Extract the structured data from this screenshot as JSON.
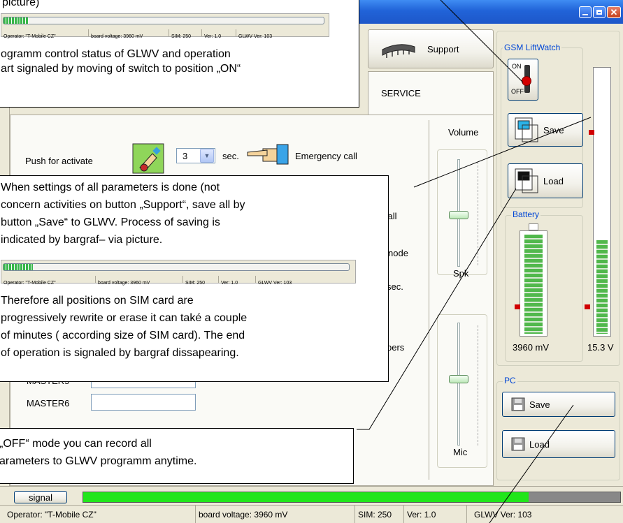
{
  "window": {
    "title_buttons": [
      "minimize-icon",
      "maximize-icon",
      "close-icon"
    ]
  },
  "tabs": {
    "support": "Support",
    "service": "SERVICE"
  },
  "form": {
    "push_label": "Push for activate",
    "seconds_value": "3",
    "sec_label": "sec.",
    "emergency_label": "Emergency call",
    "call_fragment": "call",
    "mode_fragment": "node",
    "sec_fragment": "sec.",
    "numbers_fragment": "bers",
    "master5_label": "MASTER5",
    "master6_label": "MASTER6"
  },
  "sliders": {
    "volume_label": "Volume",
    "spk_label": "Spk",
    "mic_label": "Mic"
  },
  "gsm": {
    "group_title": "GSM LiftWatch",
    "switch_on": "ON",
    "switch_off": "OFF",
    "switch_state": "ON",
    "save_label": "Save",
    "load_label": "Load"
  },
  "battery": {
    "group_title": "Battery",
    "voltage": "3960 mV",
    "supply_voltage": "15.3 V"
  },
  "pc": {
    "group_title": "PC",
    "save_label": "Save",
    "load_label": "Load"
  },
  "signal": {
    "button_label": "signal",
    "level_percent": 83
  },
  "status": {
    "operator": "Operator: \"T-Mobile CZ\"",
    "board_voltage": "board voltage: 3960 mV",
    "sim": "SIM: 250",
    "ver": "Ver: 1.0",
    "glwv_ver": "GLWV Ver: 103"
  },
  "mini_status": {
    "operator": "Operator: \"T-Mobile CZ\"",
    "board_voltage": "board voltage: 3960 mV",
    "sim": "SIM: 250",
    "ver": "Ver: 1.0",
    "glwv_ver": "GLWV Ver: 103"
  },
  "callouts": {
    "top_line1": "picture)",
    "top_line2": "ogramm control status of GLWV and operation",
    "top_line3": "art signaled by moving of switch to position „ON“",
    "middle_line1": "When settings of all parameters is done (not",
    "middle_line2": "concern activities on button „Support“, save all by",
    "middle_line3": "button „Save“ to GLWV. Process of saving is",
    "middle_line4": "indicated by bargraf– via picture.",
    "middle_line5": "Therefore all positions on SIM card are",
    "middle_line6": "progressively rewrite or erase it can také a couple",
    "middle_line7": "of minutes ( according size of SIM card). The end",
    "middle_line8": "of operation is signaled by bargraf dissapearing.",
    "bottom_line1": "„OFF“ mode you can record all",
    "bottom_line2": "arameters to GLWV programm  anytime."
  }
}
